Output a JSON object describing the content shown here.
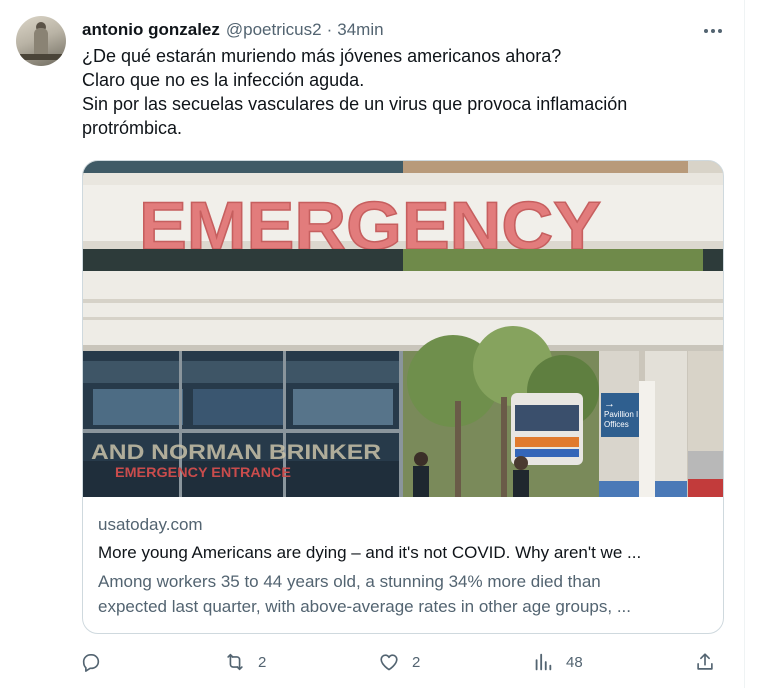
{
  "author": {
    "name": "antonio gonzalez",
    "handle": "@poetricus2",
    "separator": "·",
    "time": "34min"
  },
  "tweet_lines": [
    "¿De qué estarán muriendo más jóvenes americanos ahora?",
    "Claro que no es la infección aguda.",
    "Sin por las secuelas vasculares de un virus que provoca inflamación",
    "protrómbica."
  ],
  "card": {
    "image": {
      "sign_text": "EMERGENCY",
      "glass_text_1": "AND NORMAN BRINKER",
      "glass_text_2": "EMERGENCY ENTRANCE",
      "wayfinding_sign": [
        "Pavillion I",
        "Offices"
      ]
    },
    "domain": "usatoday.com",
    "title": "More young Americans are dying – and it's not COVID. Why aren't we ...",
    "description_lines": [
      "Among workers 35 to 44 years old, a stunning 34% more died than",
      "expected last quarter, with above-average rates in other age groups, ..."
    ]
  },
  "actions": {
    "reply": {
      "icon": "reply-icon",
      "count": ""
    },
    "retweet": {
      "icon": "retweet-icon",
      "count": "2"
    },
    "like": {
      "icon": "heart-icon",
      "count": "2"
    },
    "views": {
      "icon": "analytics-icon",
      "count": "48"
    },
    "share": {
      "icon": "share-icon",
      "count": ""
    }
  },
  "colors": {
    "text": "#0f1419",
    "secondary": "#536471",
    "border": "#cfd9de",
    "sign_letters": "#e27c7c"
  }
}
